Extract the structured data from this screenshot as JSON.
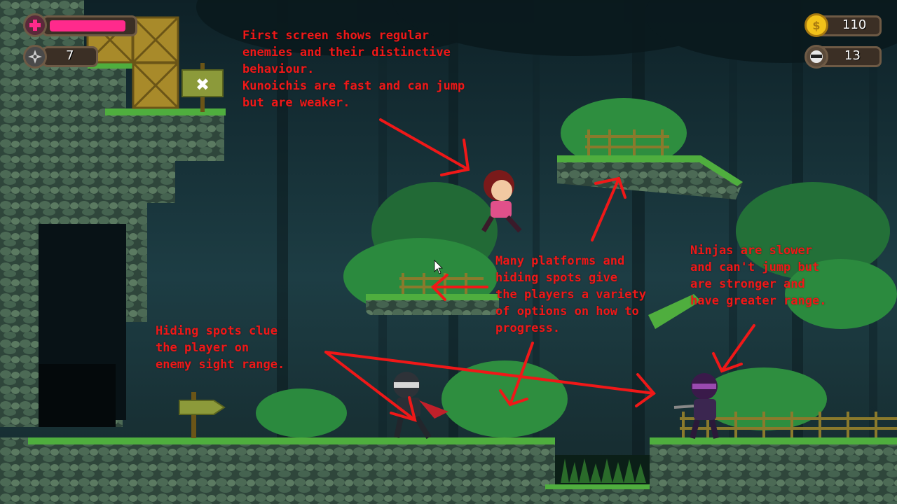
{
  "hud": {
    "health_fraction": 0.93,
    "health_color": "#ff2a8c",
    "shuriken_count": "7",
    "coins": "110",
    "enemies_count": "13",
    "icons": {
      "health": "health-cross-icon",
      "shuriken": "shuriken-icon",
      "coin": "coin-icon",
      "enemy": "ninja-head-icon"
    }
  },
  "annotations": {
    "color": "#f01818",
    "first_screen": [
      "First screen shows regular",
      "enemies and their distinctive",
      "behaviour.",
      "Kunoichis are fast and can jump",
      "but are weaker."
    ],
    "platforms": [
      "Many platforms and",
      "hiding spots give",
      "the players a variety",
      "of options on how to",
      "progress."
    ],
    "ninjas": [
      "Ninjas are slower",
      "and can't jump but",
      "are stronger and",
      "have greater range."
    ],
    "hiding": [
      "Hiding spots clue",
      "the player on",
      "enemy sight range."
    ]
  },
  "scene": {
    "sign_symbol": "✖",
    "colors": {
      "sky": "#132a30",
      "grass": "#4fae3e",
      "stone": "#3f5a48",
      "crate": "#a88a2a"
    }
  }
}
